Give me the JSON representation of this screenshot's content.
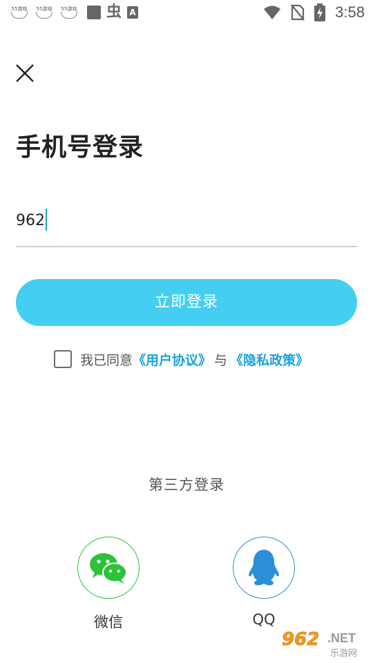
{
  "status_bar": {
    "notifications": [
      {
        "icon": "55-kaopu-app-icon",
        "text": "55游戏"
      },
      {
        "icon": "55-kaopu-app-icon",
        "text": "55游戏"
      },
      {
        "icon": "55-kaopu-app-icon",
        "text": "55游戏"
      }
    ],
    "time": "3:58"
  },
  "page": {
    "title": "手机号登录"
  },
  "phone": {
    "value": "962"
  },
  "login_button": {
    "label": "立即登录"
  },
  "agreement": {
    "prefix": "我已同意",
    "user_agreement": "《用户协议》",
    "conjunction": "与",
    "privacy_policy": "《隐私政策》",
    "checked": false
  },
  "third_party": {
    "title": "第三方登录",
    "options": [
      {
        "label": "微信",
        "icon": "wechat-icon",
        "color": "#2ec13a"
      },
      {
        "label": "QQ",
        "icon": "qq-icon",
        "color": "#2a8fd6"
      }
    ]
  },
  "watermark": {
    "brand": "962",
    "suffix": ".NET",
    "subtitle": "乐游网"
  },
  "colors": {
    "accent": "#44cff2",
    "link": "#1ba2dc"
  }
}
